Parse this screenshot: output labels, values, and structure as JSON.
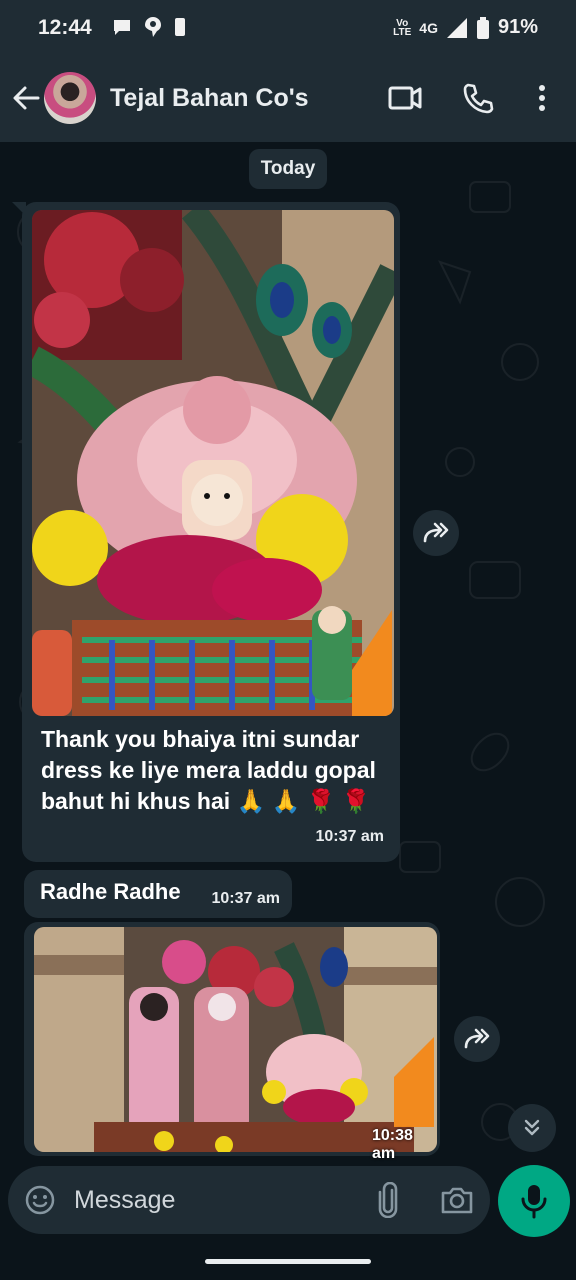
{
  "status_bar": {
    "time": "12:44",
    "network": "4G",
    "volte_top": "Vo",
    "volte_bottom": "LTE",
    "battery": "91%"
  },
  "header": {
    "contact_name": "Tejal Bahan Co's",
    "icons": [
      "back-arrow-icon",
      "video-call-icon",
      "voice-call-icon",
      "more-options-icon"
    ]
  },
  "chat": {
    "date_label": "Today",
    "messages": [
      {
        "type": "image",
        "caption": "Thank you bhaiya itni sundar dress ke liye mera laddu gopal bahut hi khus hai 🙏 🙏 🌹 🌹",
        "time": "10:37 am"
      },
      {
        "type": "text",
        "text": "Radhe Radhe",
        "time": "10:37 am"
      },
      {
        "type": "image",
        "caption": "",
        "time": "10:38 am"
      }
    ]
  },
  "input": {
    "placeholder": "Message"
  },
  "colors": {
    "header_bg": "#1f2c34",
    "chat_bg": "#0b141a",
    "bubble_bg": "#1f2c34",
    "accent": "#00a884"
  }
}
